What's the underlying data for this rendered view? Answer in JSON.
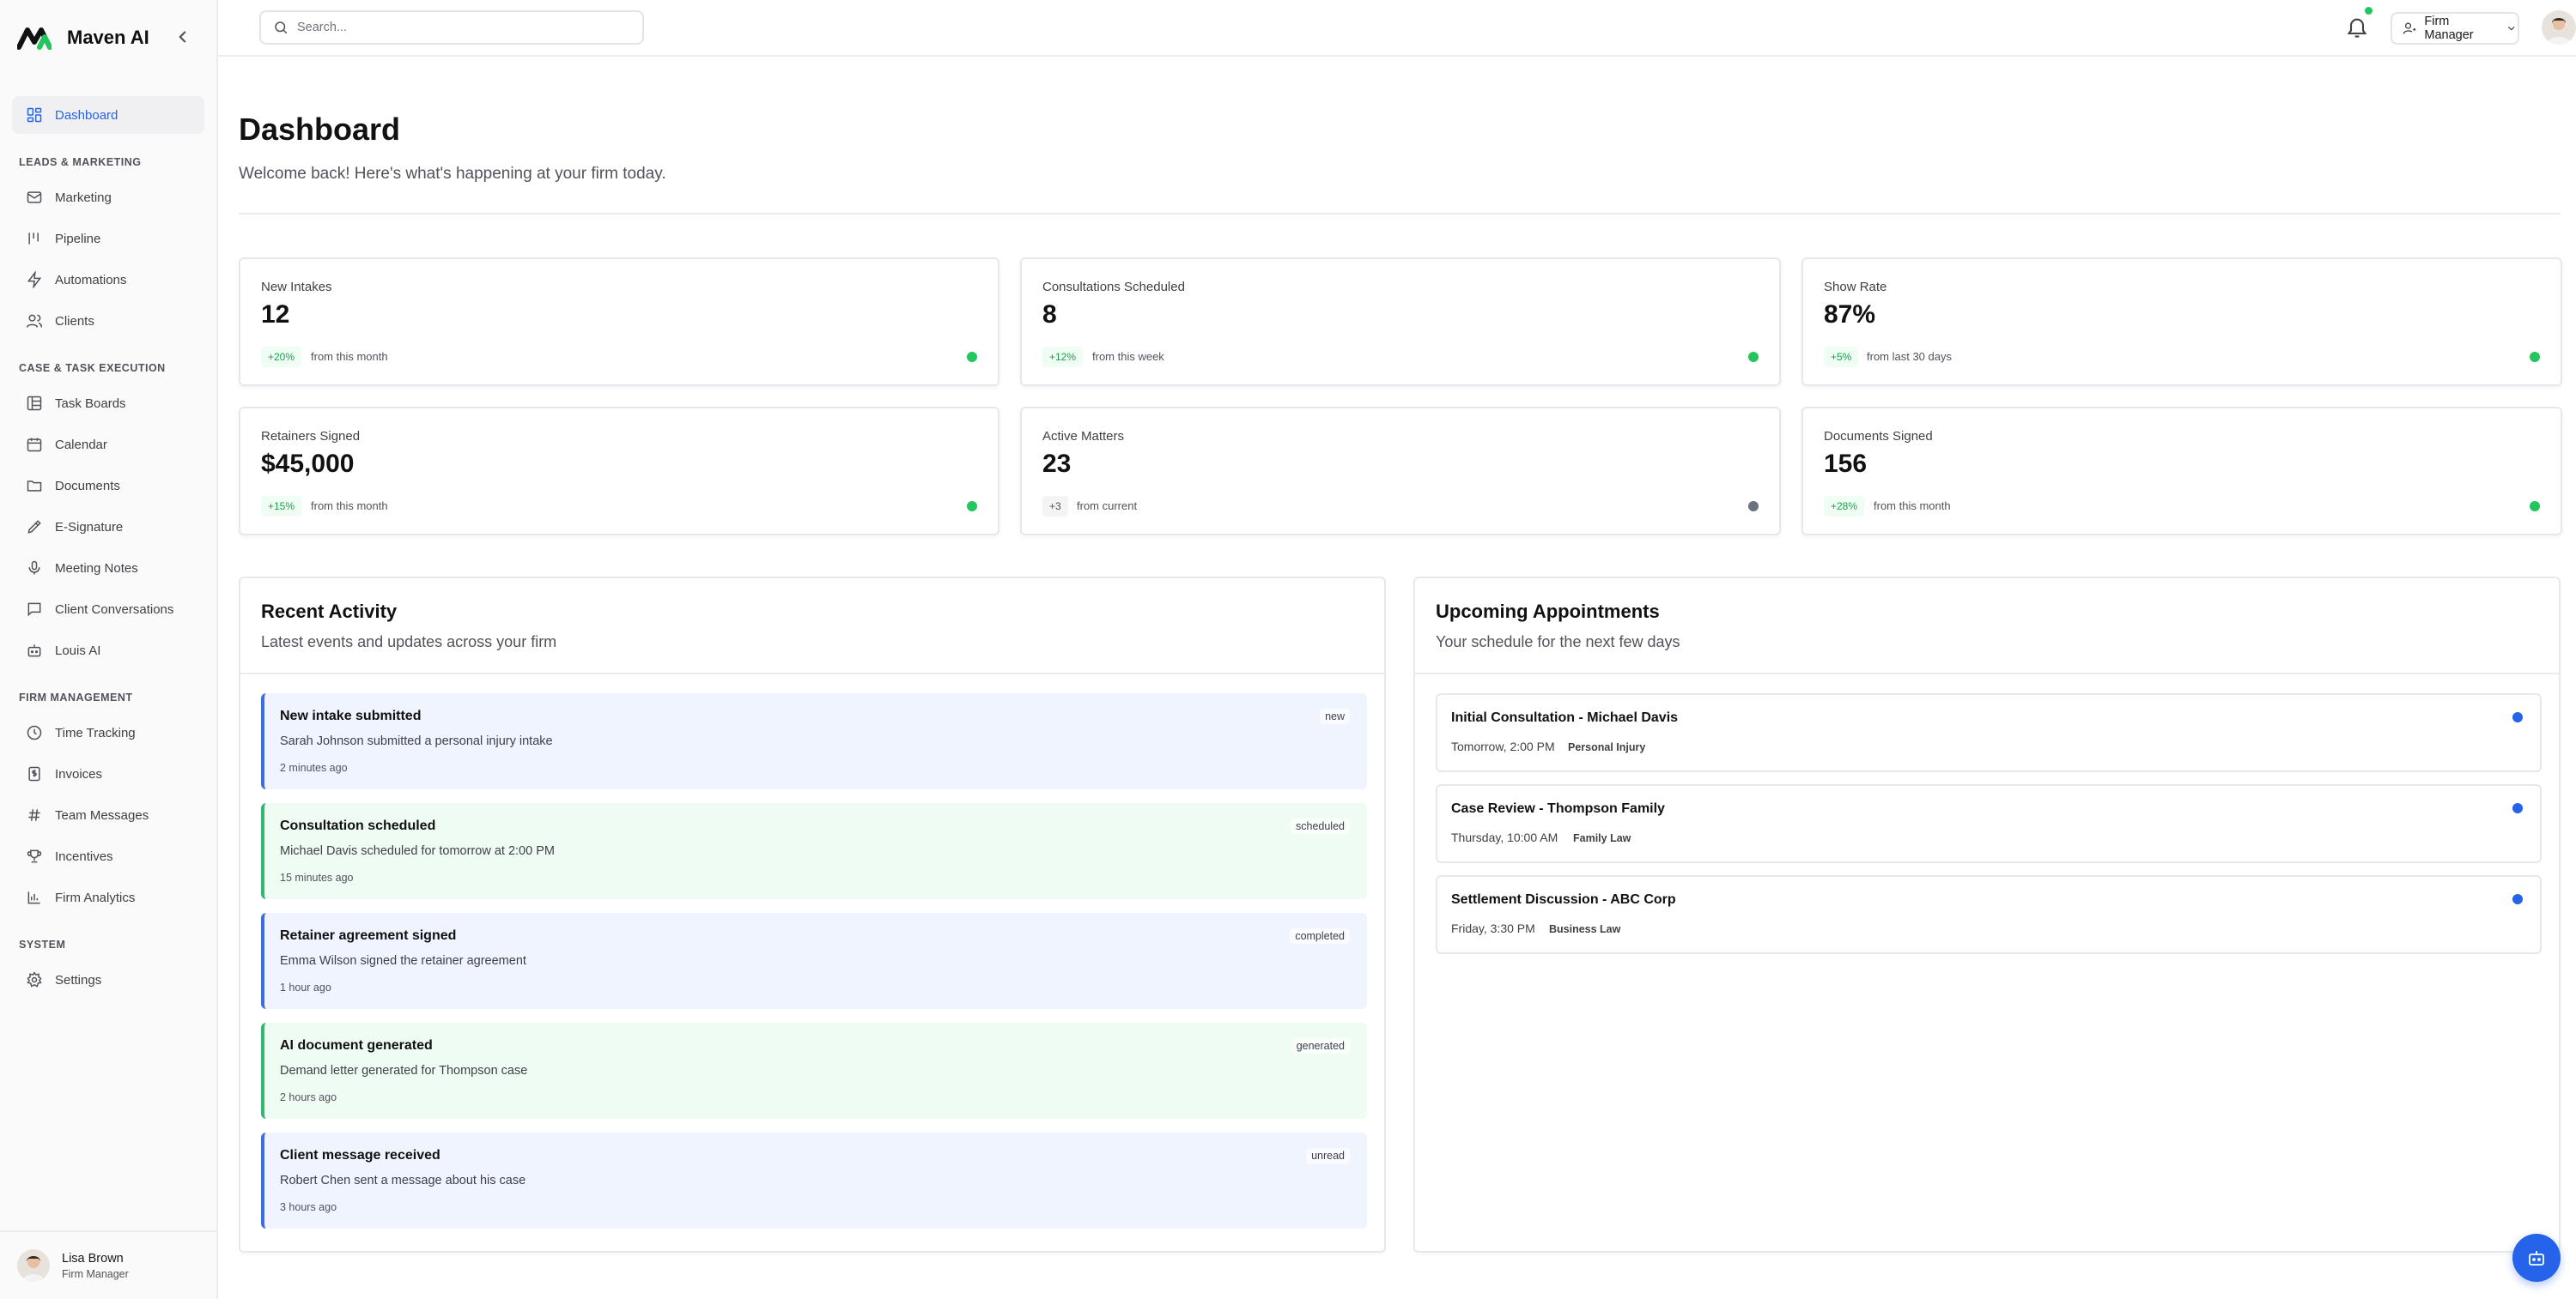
{
  "brand": {
    "name": "Maven AI"
  },
  "sidebar": {
    "dashboard": "Dashboard",
    "sections": [
      {
        "label": "LEADS & MARKETING",
        "items": [
          "Marketing",
          "Pipeline",
          "Automations",
          "Clients"
        ]
      },
      {
        "label": "CASE & TASK EXECUTION",
        "items": [
          "Task Boards",
          "Calendar",
          "Documents",
          "E-Signature",
          "Meeting Notes",
          "Client Conversations",
          "Louis AI"
        ]
      },
      {
        "label": "FIRM MANAGEMENT",
        "items": [
          "Time Tracking",
          "Invoices",
          "Team Messages",
          "Incentives",
          "Firm Analytics"
        ]
      },
      {
        "label": "SYSTEM",
        "items": [
          "Settings"
        ]
      }
    ],
    "user": {
      "name": "Lisa Brown",
      "role": "Firm Manager"
    }
  },
  "header": {
    "search_placeholder": "Search...",
    "role_label": "Firm Manager"
  },
  "page": {
    "title": "Dashboard",
    "subtitle": "Welcome back! Here's what's happening at your firm today."
  },
  "stats": [
    {
      "label": "New Intakes",
      "value": "12",
      "delta": "+20%",
      "note": "from this month",
      "status_color": "#22c55e"
    },
    {
      "label": "Consultations Scheduled",
      "value": "8",
      "delta": "+12%",
      "note": "from this week",
      "status_color": "#22c55e"
    },
    {
      "label": "Show Rate",
      "value": "87%",
      "delta": "+5%",
      "note": "from last 30 days",
      "status_color": "#22c55e"
    },
    {
      "label": "Retainers Signed",
      "value": "$45,000",
      "delta": "+15%",
      "note": "from this month",
      "status_color": "#22c55e"
    },
    {
      "label": "Active Matters",
      "value": "23",
      "delta": "+3",
      "note": "from current",
      "status_color": "#6b7280"
    },
    {
      "label": "Documents Signed",
      "value": "156",
      "delta": "+28%",
      "note": "from this month",
      "status_color": "#22c55e"
    }
  ],
  "recent_activity": {
    "title": "Recent Activity",
    "subtitle": "Latest events and updates across your firm",
    "items": [
      {
        "title": "New intake submitted",
        "desc": "Sarah Johnson submitted a personal injury intake",
        "time": "2 minutes ago",
        "tag": "new",
        "tone": "blue"
      },
      {
        "title": "Consultation scheduled",
        "desc": "Michael Davis scheduled for tomorrow at 2:00 PM",
        "time": "15 minutes ago",
        "tag": "scheduled",
        "tone": "green"
      },
      {
        "title": "Retainer agreement signed",
        "desc": "Emma Wilson signed the retainer agreement",
        "time": "1 hour ago",
        "tag": "completed",
        "tone": "blue"
      },
      {
        "title": "AI document generated",
        "desc": "Demand letter generated for Thompson case",
        "time": "2 hours ago",
        "tag": "generated",
        "tone": "green"
      },
      {
        "title": "Client message received",
        "desc": "Robert Chen sent a message about his case",
        "time": "3 hours ago",
        "tag": "unread",
        "tone": "blue"
      }
    ]
  },
  "appointments": {
    "title": "Upcoming Appointments",
    "subtitle": "Your schedule for the next few days",
    "items": [
      {
        "title": "Initial Consultation - Michael Davis",
        "time": "Tomorrow, 2:00 PM",
        "category": "Personal Injury"
      },
      {
        "title": "Case Review - Thompson Family",
        "time": "Thursday, 10:00 AM",
        "category": "Family Law"
      },
      {
        "title": "Settlement Discussion - ABC Corp",
        "time": "Friday, 3:30 PM",
        "category": "Business Law"
      }
    ]
  },
  "colors": {
    "accent": "#2563eb",
    "success": "#22c55e"
  },
  "icons": {
    "fab": "robot-icon",
    "notifications": "bell-icon"
  }
}
